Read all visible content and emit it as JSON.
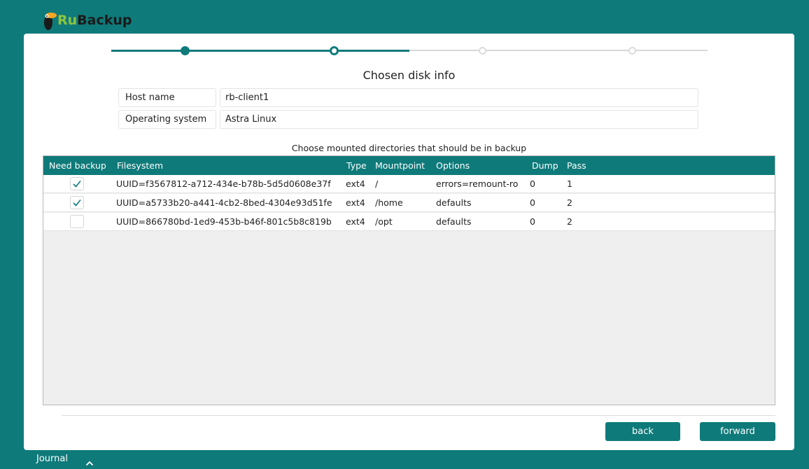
{
  "app": {
    "logo_ru": "Ru",
    "logo_backup": "Backup"
  },
  "wizard": {
    "steps_total": 4,
    "current_step": 2,
    "title": "Chosen disk info"
  },
  "info": {
    "host_label": "Host name",
    "host_value": "rb-client1",
    "os_label": "Operating system",
    "os_value": "Astra Linux"
  },
  "table": {
    "caption": "Choose mounted directories that should be in backup",
    "columns": {
      "need_backup": "Need backup",
      "filesystem": "Filesystem",
      "type": "Type",
      "mountpoint": "Mountpoint",
      "options": "Options",
      "dump": "Dump",
      "pass": "Pass"
    },
    "rows": [
      {
        "checked": true,
        "filesystem": "UUID=f3567812-a712-434e-b78b-5d5d0608e37f",
        "type": "ext4",
        "mountpoint": "/",
        "options": "errors=remount-ro",
        "dump": "0",
        "pass": "1"
      },
      {
        "checked": true,
        "filesystem": "UUID=a5733b20-a441-4cb2-8bed-4304e93d51fe",
        "type": "ext4",
        "mountpoint": "/home",
        "options": "defaults",
        "dump": "0",
        "pass": "2"
      },
      {
        "checked": false,
        "filesystem": "UUID=866780bd-1ed9-453b-b46f-801c5b8c819b",
        "type": "ext4",
        "mountpoint": "/opt",
        "options": "defaults",
        "dump": "0",
        "pass": "2"
      }
    ]
  },
  "buttons": {
    "back": "back",
    "forward": "forward"
  },
  "footer": {
    "journal": "Journal"
  },
  "colors": {
    "accent": "#0f7a7a",
    "inactive": "#d8d8d8",
    "logo_green": "#8cc63f"
  },
  "icons": {
    "logo": "toucan-logo-icon",
    "checkmark": "checkmark-icon",
    "caret": "chevron-up-icon"
  }
}
